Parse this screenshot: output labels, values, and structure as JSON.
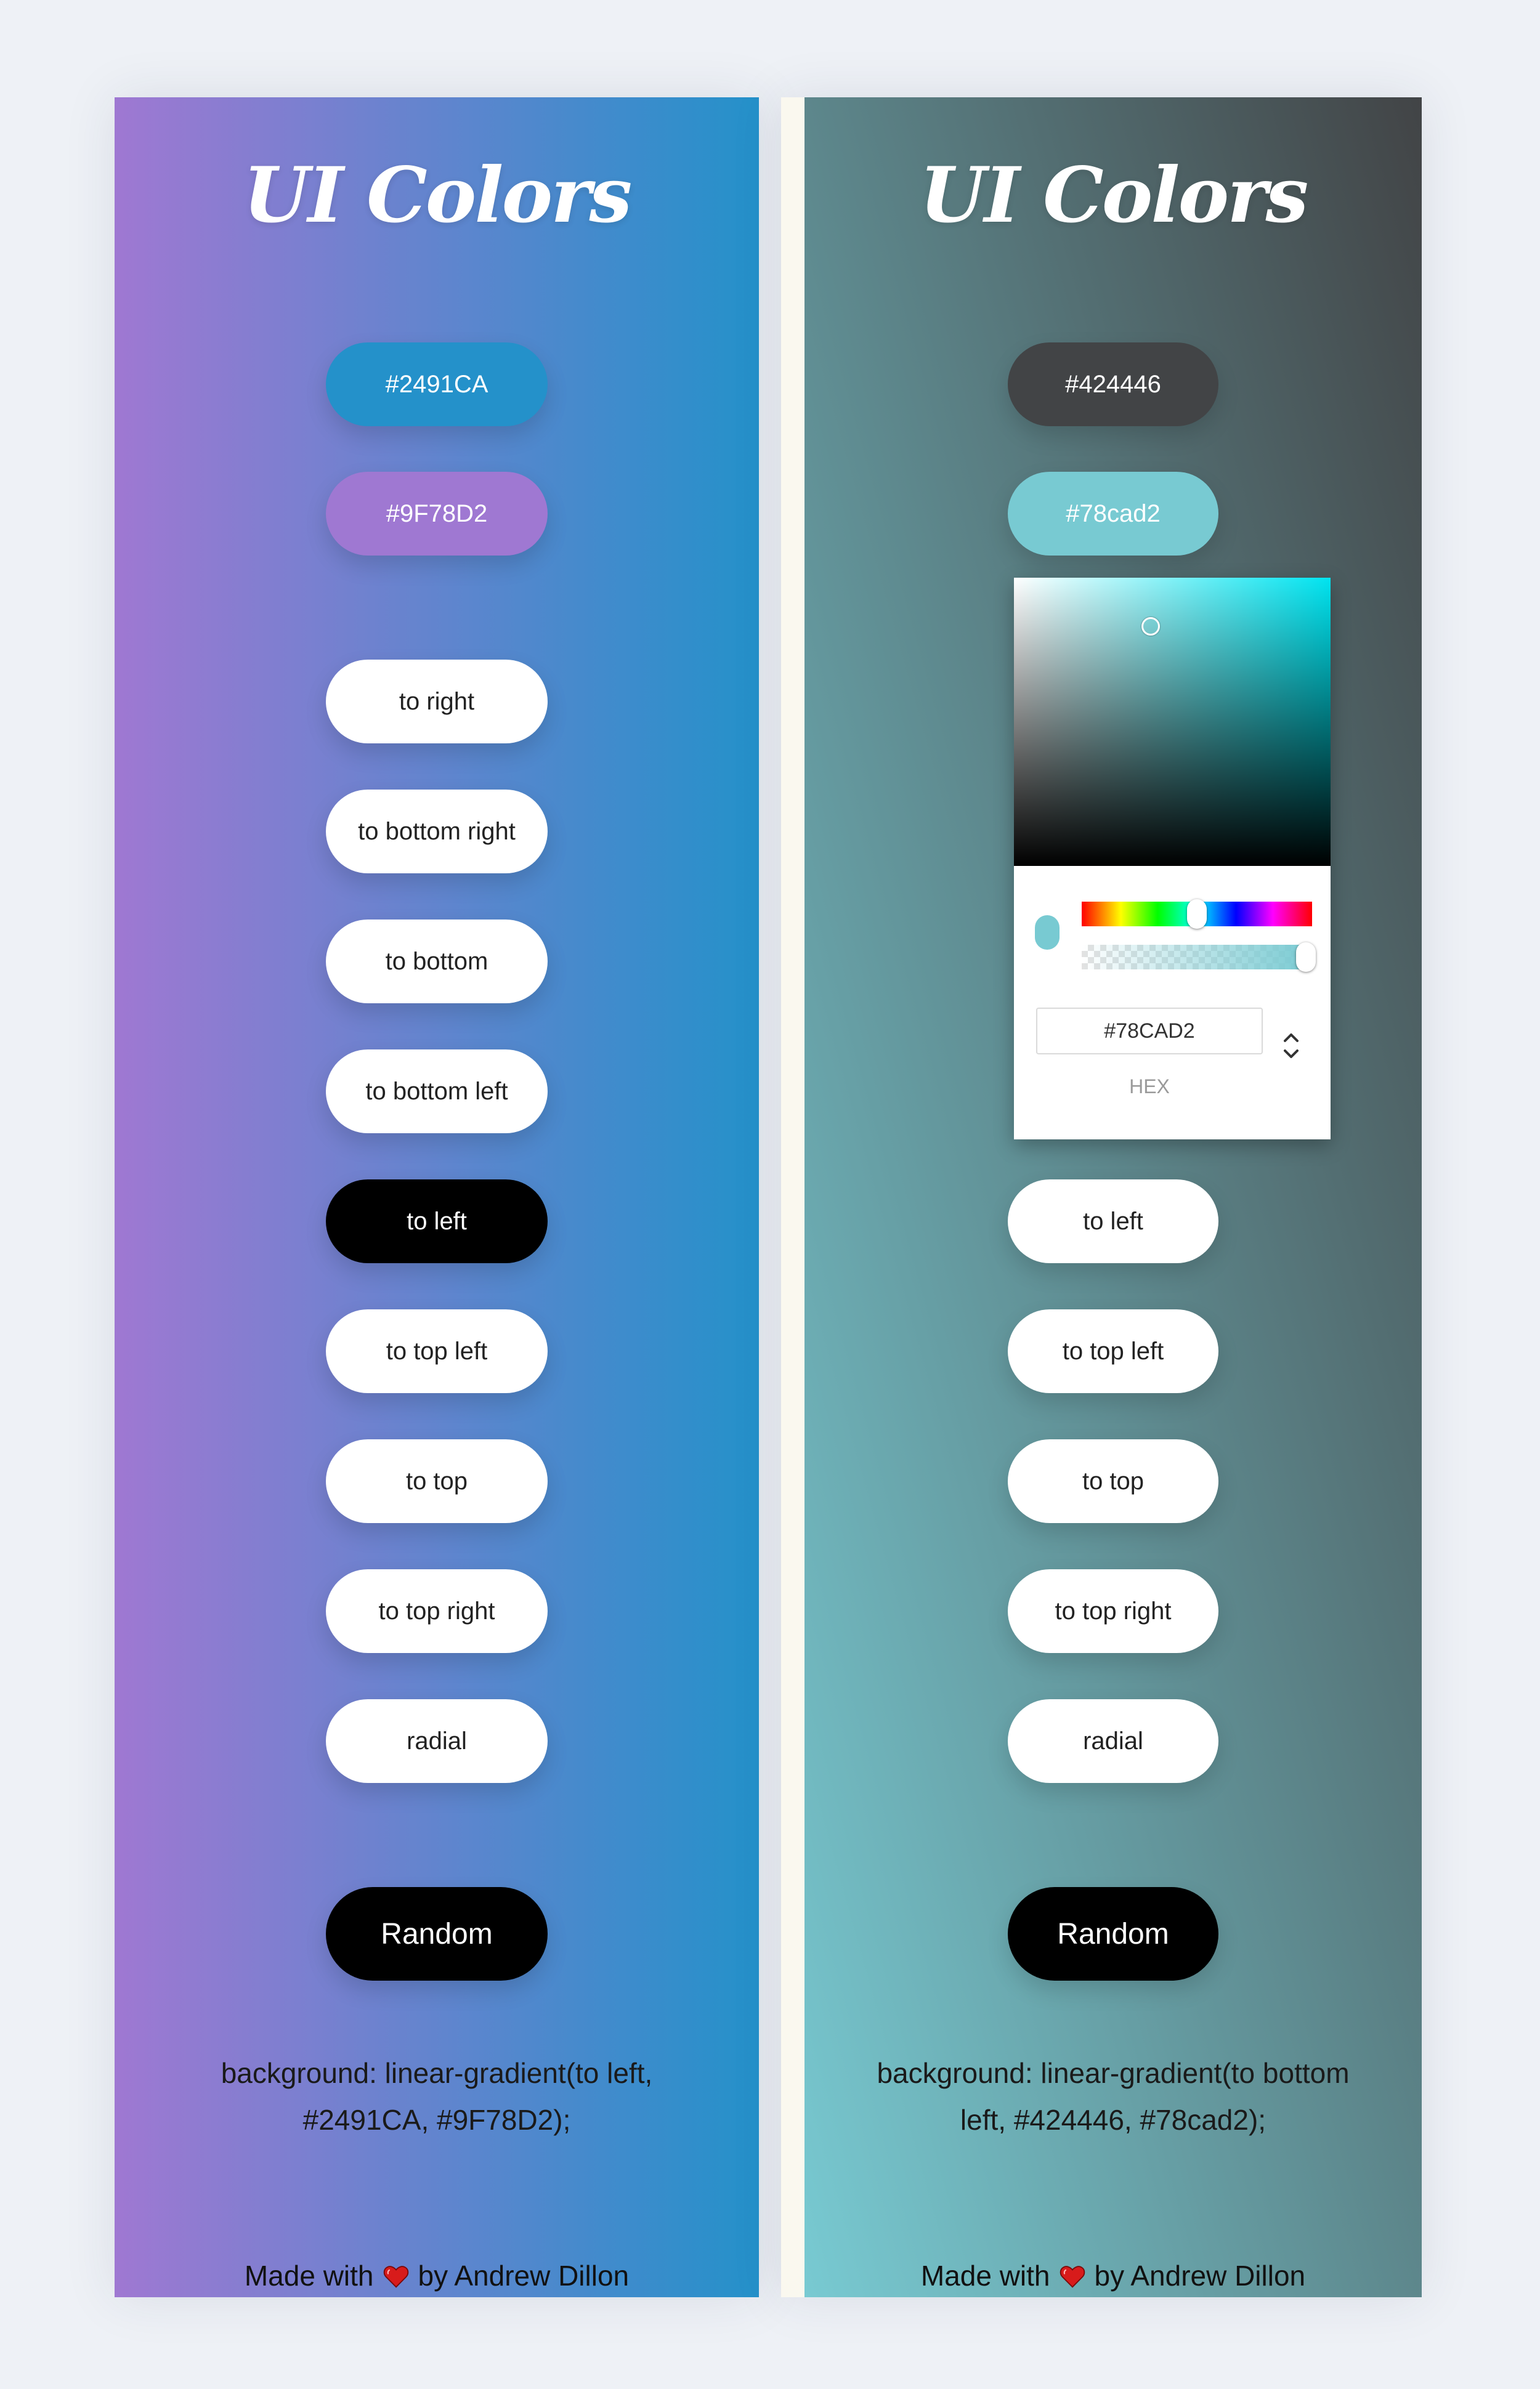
{
  "colors": {
    "page_bg": "#eef1f6",
    "button_bg": "#ffffff",
    "button_active_bg": "#000000",
    "heart": "#d81b1b"
  },
  "left_app": {
    "title": "UI Colors",
    "color1": {
      "label": "#2491CA",
      "value": "#2491CA"
    },
    "color2": {
      "label": "#9F78D2",
      "value": "#9F78D2"
    },
    "directions": [
      {
        "label": "to right",
        "active": false
      },
      {
        "label": "to bottom right",
        "active": false
      },
      {
        "label": "to bottom",
        "active": false
      },
      {
        "label": "to bottom left",
        "active": false
      },
      {
        "label": "to left",
        "active": true
      },
      {
        "label": "to top left",
        "active": false
      },
      {
        "label": "to top",
        "active": false
      },
      {
        "label": "to top right",
        "active": false
      },
      {
        "label": "radial",
        "active": false
      }
    ],
    "random_label": "Random",
    "css_output": "background: linear-gradient(to left, #2491CA, #9F78D2);",
    "footer": {
      "prefix": "Made with",
      "suffix": "by Andrew Dillon",
      "heart_icon": "heart-icon"
    }
  },
  "right_app": {
    "title": "UI Colors",
    "color1": {
      "label": "#424446",
      "value": "#424446"
    },
    "color2": {
      "label": "#78cad2",
      "value": "#78cad2"
    },
    "picker": {
      "hex_value": "#78CAD2",
      "mode_label": "HEX",
      "hue_color": "#00e4f0",
      "preview_color": "#78cad2",
      "toggle_icon": "chevron-up-down-icon"
    },
    "directions": [
      {
        "label": "to left",
        "active": false
      },
      {
        "label": "to top left",
        "active": false
      },
      {
        "label": "to top",
        "active": false
      },
      {
        "label": "to top right",
        "active": false
      },
      {
        "label": "radial",
        "active": false
      }
    ],
    "random_label": "Random",
    "css_output": "background: linear-gradient(to bottom left, #424446, #78cad2);",
    "footer": {
      "prefix": "Made with",
      "suffix": "by Andrew Dillon",
      "heart_icon": "heart-icon"
    }
  }
}
